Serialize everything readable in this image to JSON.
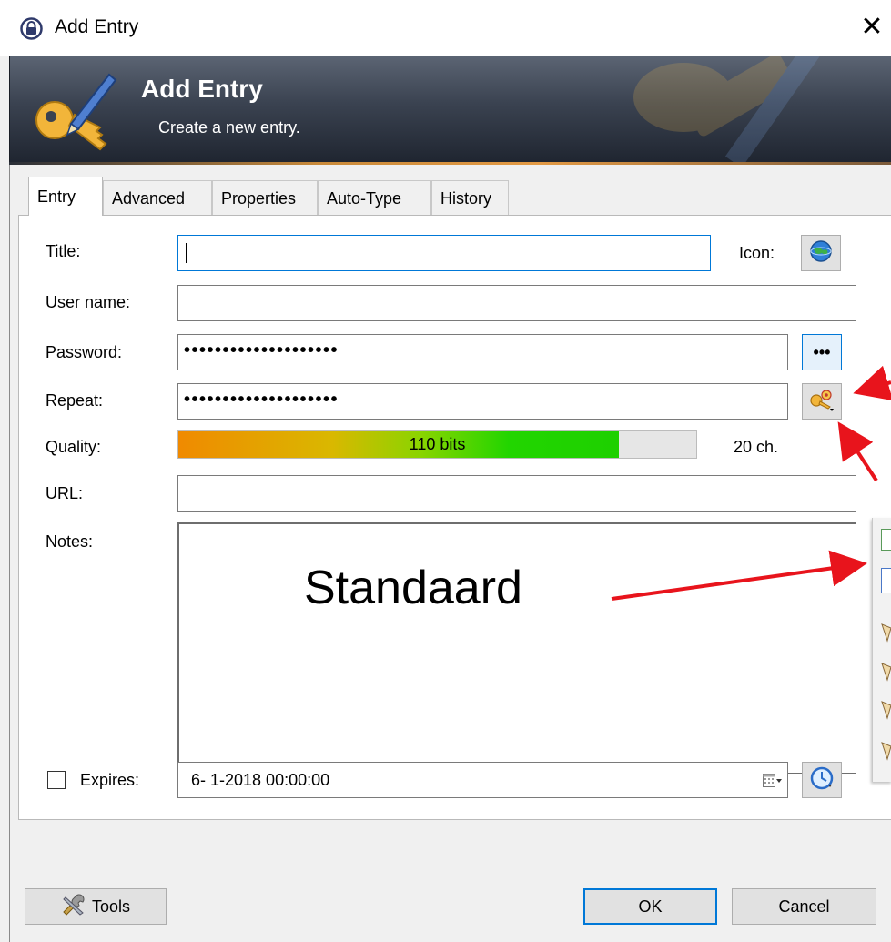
{
  "window": {
    "title": "Add Entry",
    "close_symbol": "✕"
  },
  "banner": {
    "title": "Add Entry",
    "subtitle": "Create a new entry."
  },
  "tabs": [
    {
      "label": "Entry",
      "active": true
    },
    {
      "label": "Advanced",
      "active": false
    },
    {
      "label": "Properties",
      "active": false
    },
    {
      "label": "Auto-Type",
      "active": false
    },
    {
      "label": "History",
      "active": false
    }
  ],
  "form": {
    "title_label": "Title:",
    "title_value": "",
    "icon_label": "Icon:",
    "username_label": "User name:",
    "username_value": "",
    "password_label": "Password:",
    "password_value": "••••••••••••••••••••",
    "show_password_label": "•••",
    "repeat_label": "Repeat:",
    "repeat_value": "••••••••••••••••••••",
    "quality_label": "Quality:",
    "quality_text": "110 bits",
    "quality_fraction": 0.85,
    "char_count": "20 ch.",
    "url_label": "URL:",
    "url_value": "",
    "notes_label": "Notes:",
    "notes_value": "",
    "expires_label": "Expires:",
    "expires_checked": false,
    "expires_value": "6- 1-2018 00:00:00"
  },
  "annotation": {
    "text": "Standaard",
    "color": "#e8141c"
  },
  "buttons": {
    "tools": "Tools",
    "ok": "OK",
    "cancel": "Cancel"
  },
  "colors": {
    "accent": "#0078d7",
    "banner": "#2d3440",
    "arrow": "#e8141c"
  },
  "icons": [
    "keepass-lock-icon",
    "key-pen-icon",
    "globe-icon",
    "password-generator-icon",
    "calendar-icon",
    "clock-icon",
    "tools-icon"
  ]
}
